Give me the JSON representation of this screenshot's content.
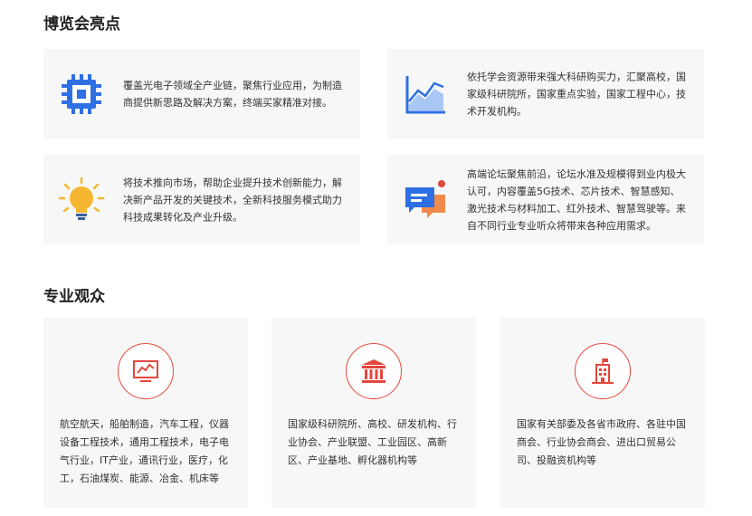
{
  "highlights": {
    "title": "博览会亮点",
    "cards": [
      {
        "icon": "chip-icon",
        "text": "覆盖光电子领域全产业链，聚焦行业应用，为制造商提供新思路及解决方案，终端买家精准对接。"
      },
      {
        "icon": "area-chart-icon",
        "text": "依托学会资源带来强大科研购买力，汇聚高校，国家级科研院所，国家重点实验，国家工程中心，技术开发机构。"
      },
      {
        "icon": "lightbulb-icon",
        "text": "将技术推向市场，帮助企业提升技术创新能力，解决新产品开发的关键技术，全新科技服务模式助力科技成果转化及产业升级。"
      },
      {
        "icon": "chat-bubbles-icon",
        "text": "高端论坛聚焦前沿，论坛水准及规模得到业内极大认可，内容覆盖5G技术、芯片技术、智慧感知、激光技术与材料加工、红外技术、智慧驾驶等。来自不同行业专业听众将带来各种应用需求。"
      }
    ]
  },
  "audience": {
    "title": "专业观众",
    "cards": [
      {
        "icon": "line-chart-monitor-icon",
        "text": "航空航天，船舶制造，汽车工程，仪器设备工程技术，通用工程技术，电子电气行业，IT产业，通讯行业，医疗，化工，石油煤炭、能源、冶金、机床等"
      },
      {
        "icon": "institution-building-icon",
        "text": "国家级科研院所、高校、研发机构、行业协会、产业联盟、工业园区、高新区、产业基地、孵化器机构等"
      },
      {
        "icon": "government-building-icon",
        "text": "国家有关部委及各省市政府、各驻中国商会、行业协会商会、进出口贸易公司、投融资机构等"
      }
    ]
  },
  "colors": {
    "accent_blue": "#2f6fe4",
    "accent_red": "#e3463b",
    "bulb_yellow": "#f5b731",
    "card_bg": "#f7f7f7"
  }
}
